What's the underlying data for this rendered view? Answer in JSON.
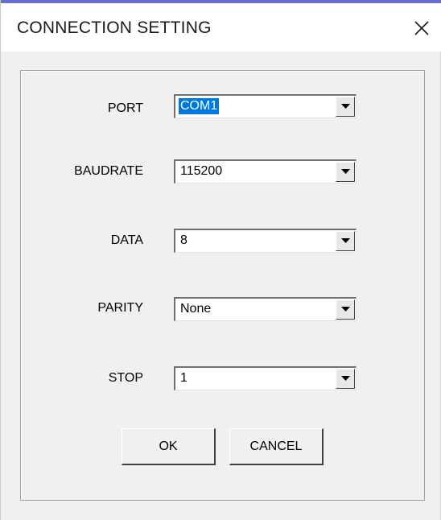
{
  "window": {
    "title": "CONNECTION SETTING"
  },
  "fields": {
    "port": {
      "label": "PORT",
      "value": "COM1"
    },
    "baudrate": {
      "label": "BAUDRATE",
      "value": "115200"
    },
    "data": {
      "label": "DATA",
      "value": "8"
    },
    "parity": {
      "label": "PARITY",
      "value": "None"
    },
    "stop": {
      "label": "STOP",
      "value": "1"
    }
  },
  "buttons": {
    "ok": "OK",
    "cancel": "CANCEL"
  },
  "colors": {
    "title_accent": "#6b6bd6",
    "selection": "#0078d7"
  }
}
